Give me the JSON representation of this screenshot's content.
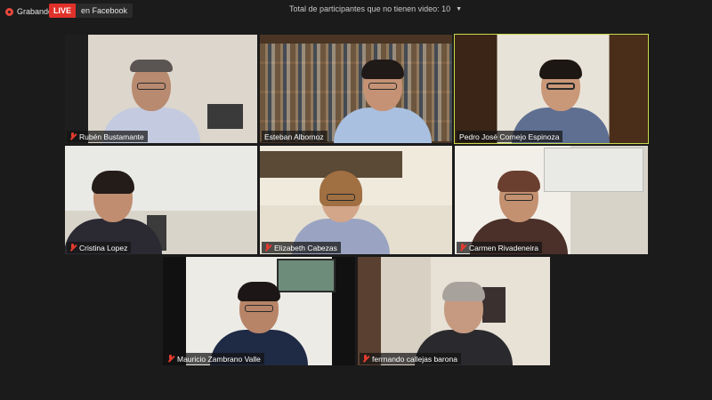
{
  "recording": {
    "label": "Grabando"
  },
  "live": {
    "badge": "LIVE",
    "target": "en Facebook"
  },
  "participants_info": "Total de participantes que no tienen video: 10",
  "colors": {
    "active_speaker_border": "#c7d94e",
    "live_red": "#e0312a",
    "muted_red": "#e33b2e"
  },
  "tiles": [
    {
      "name": "Rubén Bustamante",
      "muted": true
    },
    {
      "name": "Esteban Albornoz",
      "muted": false
    },
    {
      "name": "Pedro José Cornejo Espinoza",
      "muted": false,
      "active_speaker": true
    },
    {
      "name": "Cristina Lopez",
      "muted": true
    },
    {
      "name": "Elizabeth Cabezas",
      "muted": true
    },
    {
      "name": "Carmen Rivadeneira",
      "muted": true
    },
    {
      "name": "Mauricio Zambrano Valle",
      "muted": true
    },
    {
      "name": "ferrnando callejas barona",
      "muted": true
    }
  ]
}
